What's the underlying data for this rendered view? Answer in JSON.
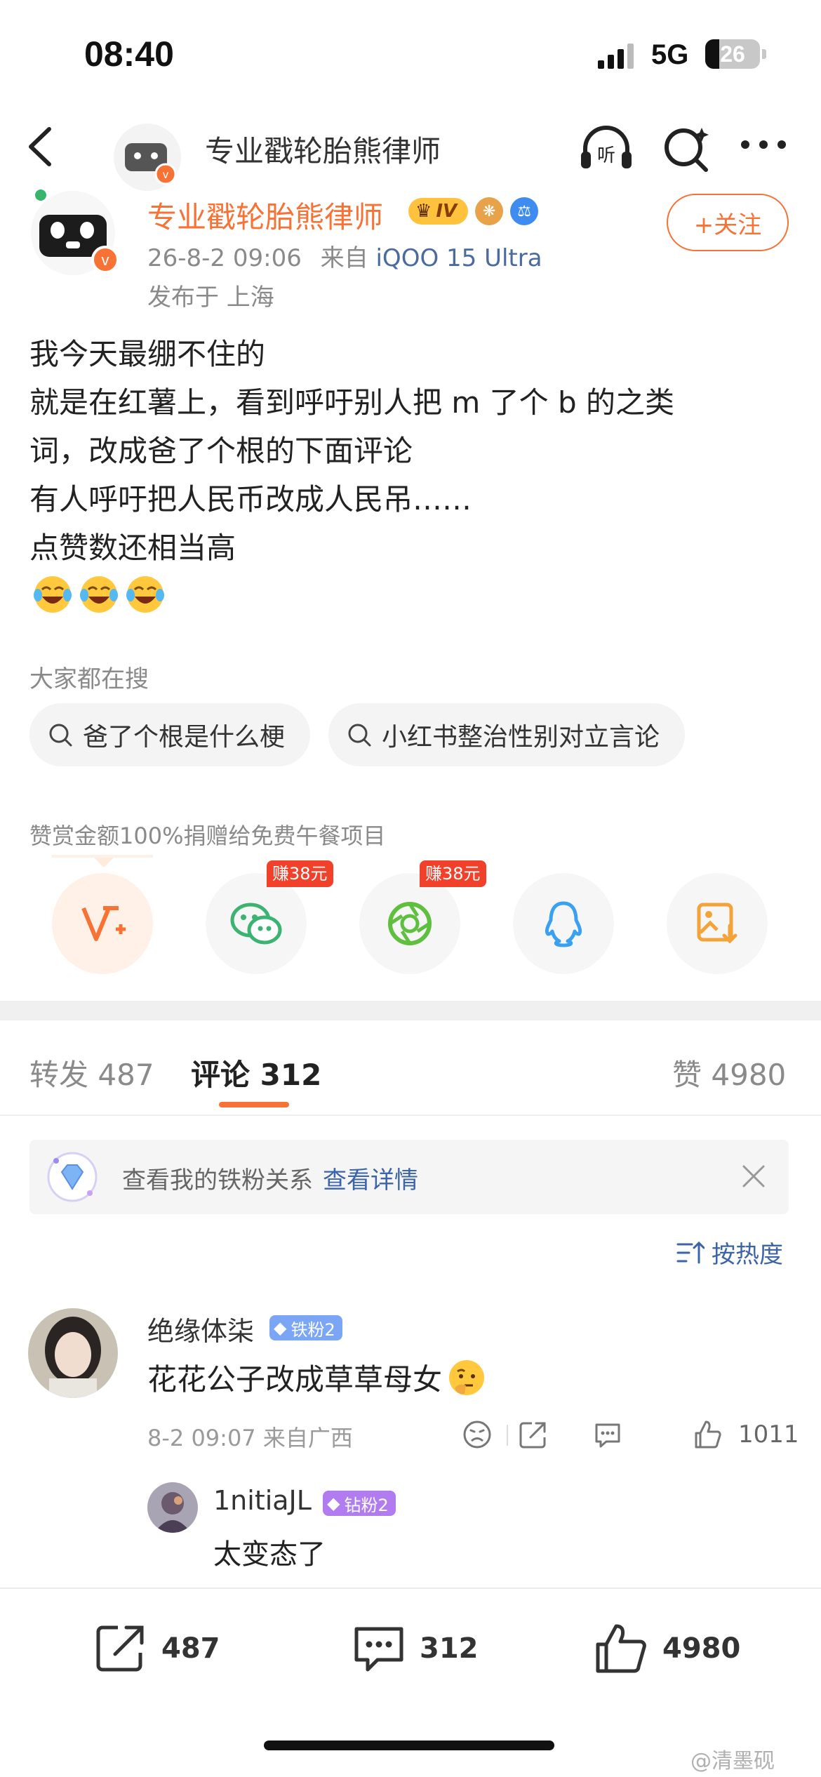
{
  "status_bar": {
    "time": "08:40",
    "network": "5G",
    "battery": "26",
    "battery_level": 0.26
  },
  "nav": {
    "title": "专业戳轮胎熊律师",
    "listen_label": "听"
  },
  "post": {
    "author": "专业戳轮胎熊律师",
    "level_badge": "IV",
    "follow_label": "+关注",
    "time": "26-8-2 09:06",
    "source_prefix": "来自",
    "source": "iQOO 15 Ultra",
    "location": "发布于 上海",
    "text_lines": [
      "我今天最绷不住的",
      "就是在红薯上，看到呼吁别人把 m 了个 b 的之类",
      "词，改成爸了个根的下面评论",
      "有人呼吁把人民币改成人民吊……",
      "点赞数还相当高"
    ],
    "emoji_names": [
      "laugh-cry-emoji",
      "laugh-cry-emoji",
      "laugh-cry-emoji"
    ]
  },
  "hot_search": {
    "title": "大家都在搜",
    "chips": [
      "爸了个根是什么梗",
      "小红书整治性别对立言论"
    ]
  },
  "reward": {
    "title": "赞赏金额100%捐赠给免费午餐项目",
    "share_icons": [
      "v-plus-icon",
      "wechat-icon",
      "moments-icon",
      "qq-icon",
      "save-image-icon"
    ],
    "earn_tags": [
      "赚38元",
      "赚38元"
    ]
  },
  "tabs": {
    "repost_label": "转发",
    "repost_count": "487",
    "comment_label": "评论",
    "comment_count": "312",
    "like_label": "赞",
    "like_count": "4980"
  },
  "fan_banner": {
    "text": "查看我的铁粉关系",
    "link": "查看详情"
  },
  "sort": {
    "label": "按热度"
  },
  "comment": {
    "user": "绝缘体柒",
    "badge": "铁粉2",
    "text": "花花公子改成草草母女",
    "time_loc": "8-2 09:07 来自广西",
    "likes": "1011",
    "reply_user": "1nitiaJL",
    "reply_badge": "钻粉2",
    "reply_text": "太变态了"
  },
  "bottom_bar": {
    "repost": "487",
    "comment": "312",
    "like": "4980"
  },
  "watermark": "@清墨砚",
  "colors": {
    "accent": "#f77234",
    "link": "#3c64a8",
    "iron_fan": "#7aa6f5",
    "diamond_fan": "#b07cf0"
  }
}
